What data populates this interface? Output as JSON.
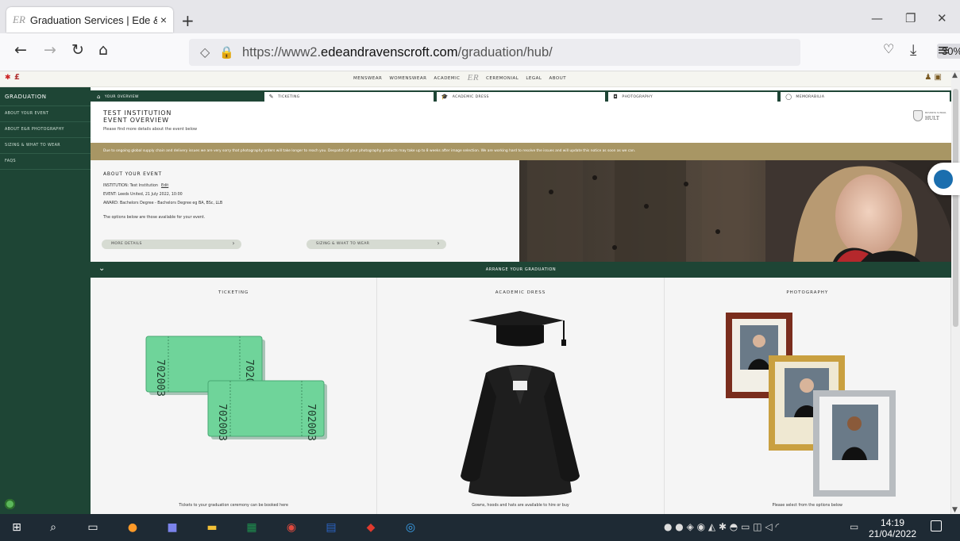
{
  "browser": {
    "tab_title": "Graduation Services | Ede & Rav",
    "tab_close": "×",
    "new_tab": "+",
    "url_prefix": "https://www2.",
    "url_domain": "edeandravenscroft.com",
    "url_path": "/graduation/hub/",
    "zoom": "30%"
  },
  "site_nav": {
    "items": [
      "MENSWEAR",
      "WOMENSWEAR",
      "ACADEMIC",
      "CEREMONIAL",
      "LEGAL",
      "ABOUT"
    ],
    "monogram": "ER",
    "currency": "£"
  },
  "sidebar": {
    "heading": "GRADUATION",
    "items": [
      "ABOUT YOUR EVENT",
      "ABOUT E&R PHOTOGRAPHY",
      "SIZING & WHAT TO WEAR",
      "FAQS"
    ]
  },
  "tabs": [
    {
      "label": "YOUR OVERVIEW",
      "icon": "home-icon",
      "glyph": "⌂"
    },
    {
      "label": "TICKETING",
      "icon": "ticket-icon",
      "glyph": "✎"
    },
    {
      "label": "ACADEMIC DRESS",
      "icon": "mortarboard-icon",
      "glyph": "🎓"
    },
    {
      "label": "PHOTOGRAPHY",
      "icon": "camera-icon",
      "glyph": "◘"
    },
    {
      "label": "MEMORABILIA",
      "icon": "shield-icon",
      "glyph": "◯"
    }
  ],
  "header": {
    "institution_line1": "TEST INSTITUTION",
    "institution_line2": "EVENT OVERVIEW",
    "subtitle": "Please find more details about the event below",
    "logo_small": "BUSINESS SCHOOL",
    "logo_text": "HULT"
  },
  "notice": "Due to ongoing global supply chain and delivery issues we are very sorry that photography orders will take longer to reach you. Despatch of your photography products may take up to 8 weeks after image selection. We are working hard to resolve the issues and will update this notice as soon as we can.",
  "about": {
    "title": "ABOUT YOUR EVENT",
    "institution": "INSTITUTION: Test Institution",
    "edit": "Edit",
    "event": "EVENT: Leeds United, 21 July 2022, 10:00",
    "award": "AWARD: Bachelors Degree - Bachelors Degree eg BA, BSc, LLB",
    "options_note": "The options below are those available for your event.",
    "more_details": "MORE DETAILS",
    "sizing": "SIZING & WHAT TO WEAR"
  },
  "arrange": {
    "title": "ARRANGE YOUR GRADUATION"
  },
  "columns": [
    {
      "title": "TICKETING",
      "caption": "Tickets to your graduation ceremony can be booked here",
      "ticket_number": "702003"
    },
    {
      "title": "ACADEMIC DRESS",
      "caption": "Gowns, hoods and hats are available to hire or buy"
    },
    {
      "title": "PHOTOGRAPHY",
      "caption": "Please select from the options below"
    }
  ],
  "taskbar": {
    "time": "14:19",
    "date": "21/04/2022"
  }
}
